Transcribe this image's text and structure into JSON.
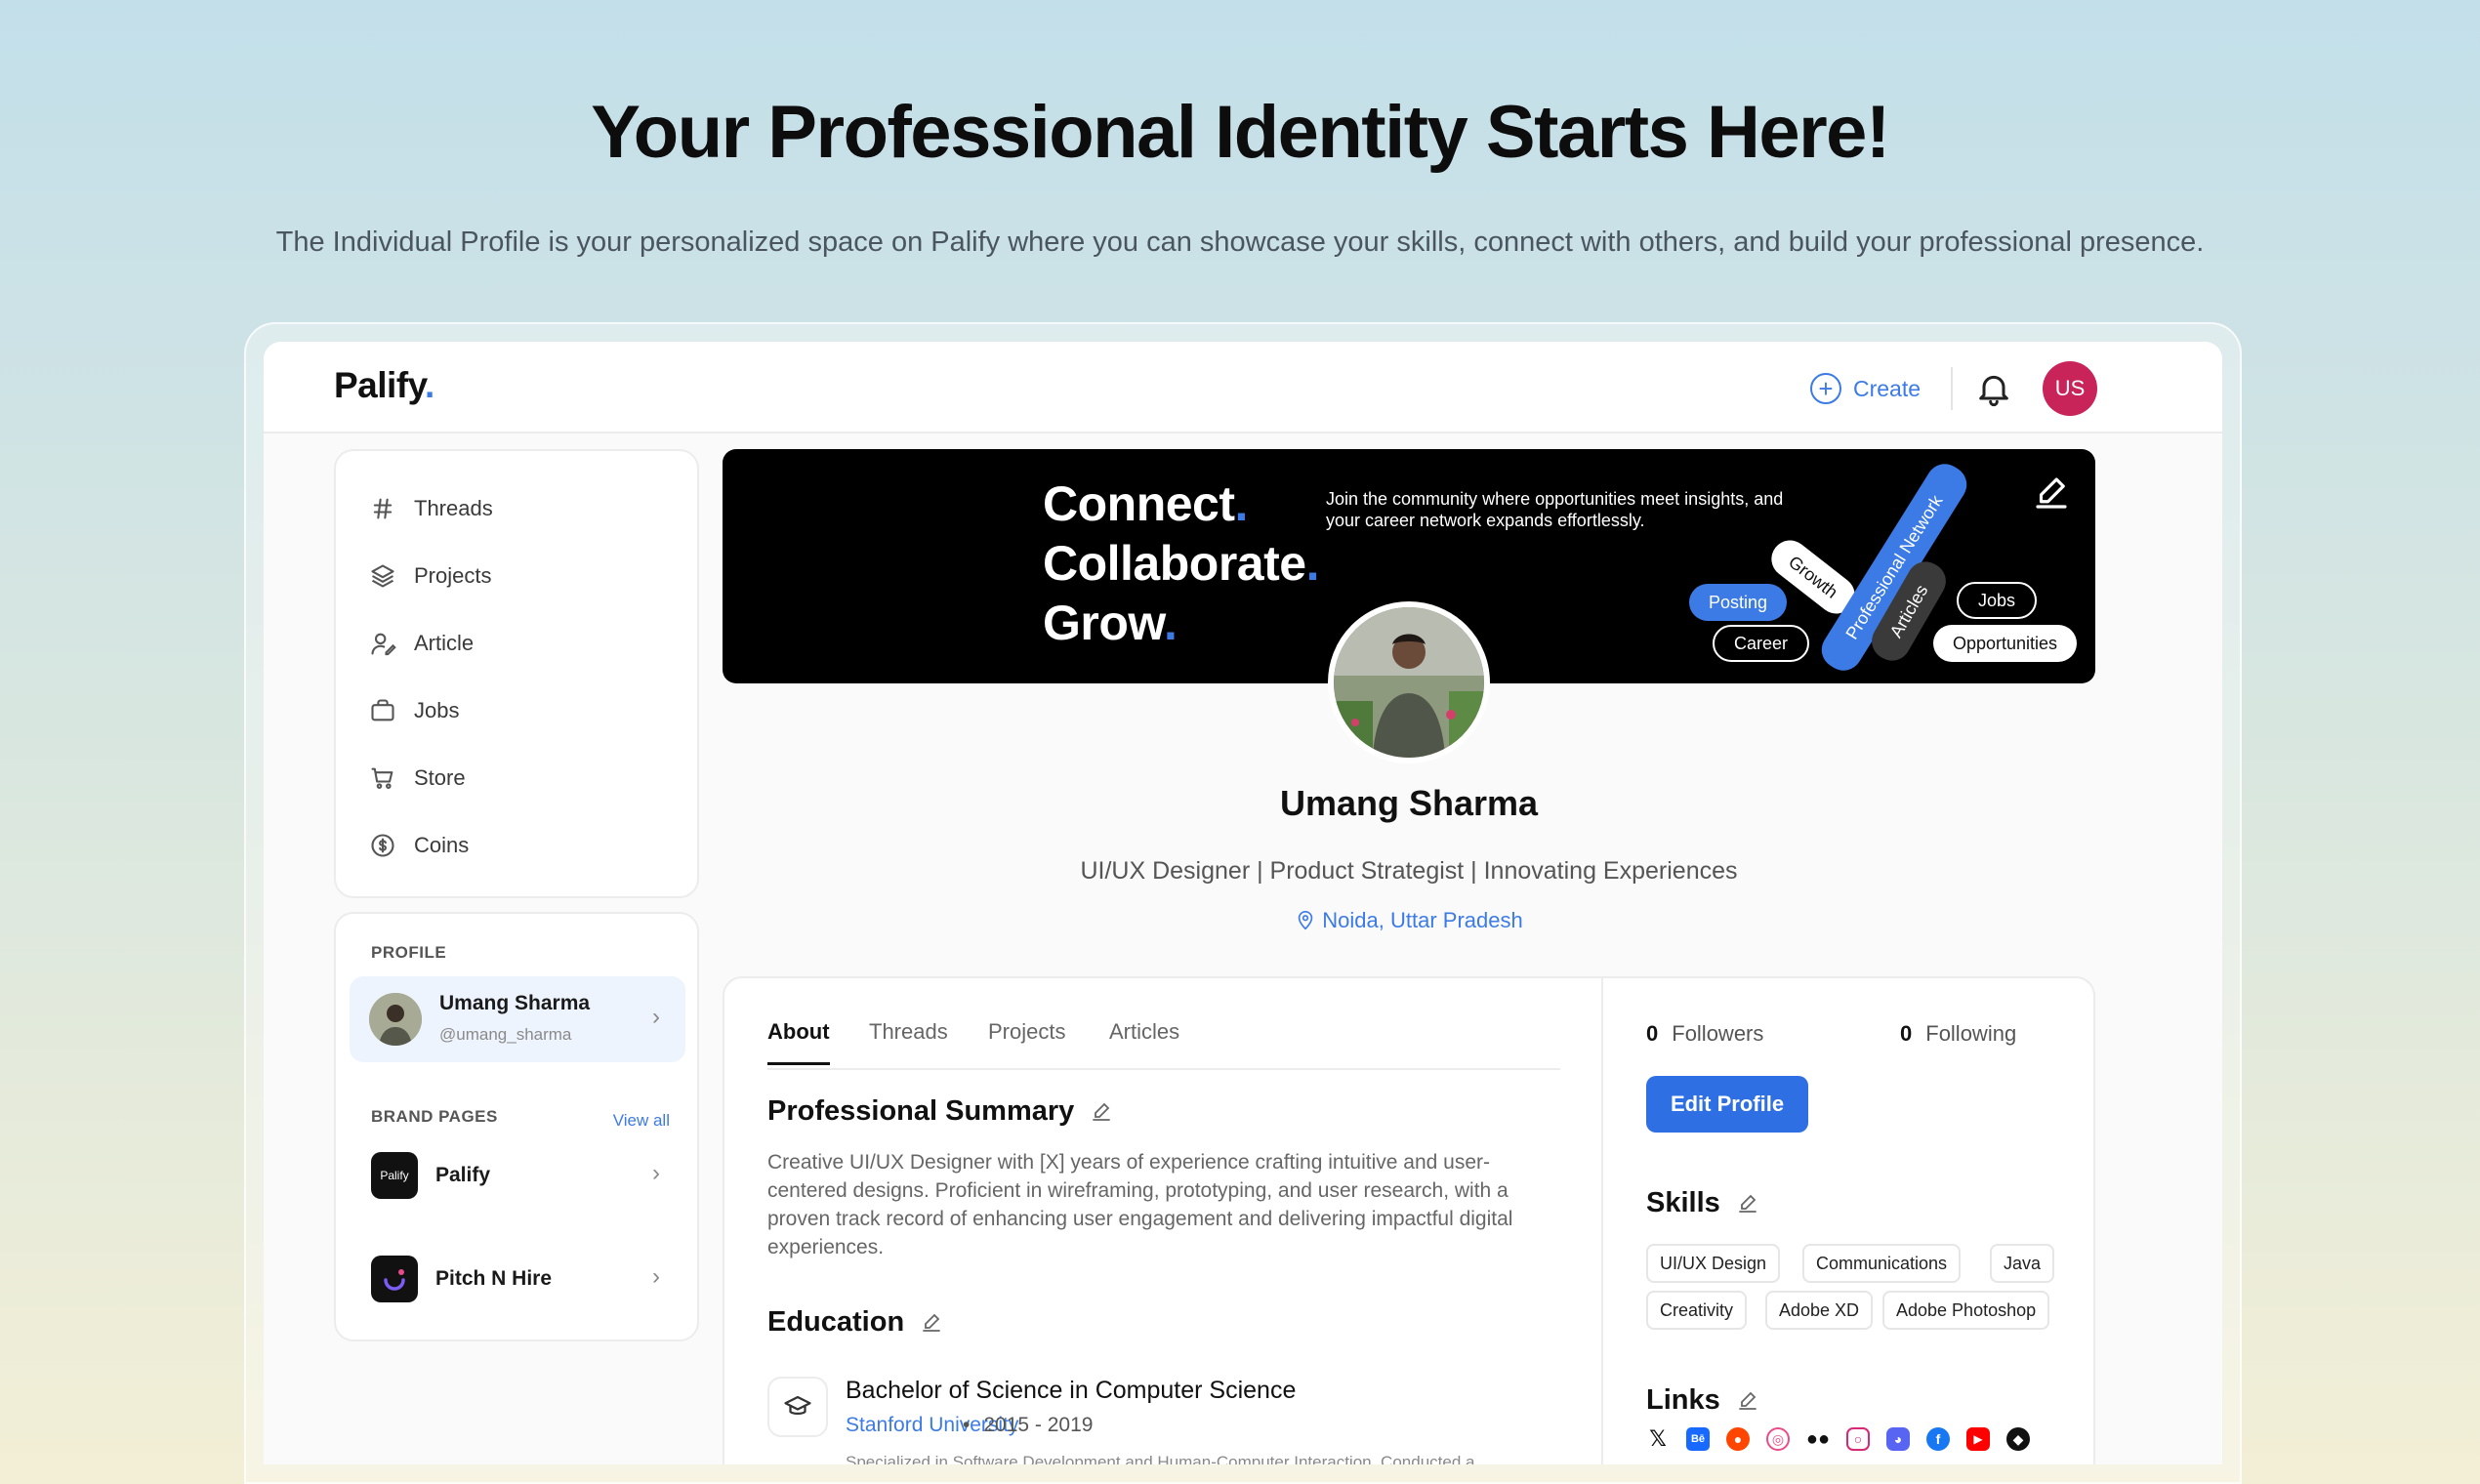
{
  "hero": {
    "title": "Your Professional Identity Starts Here!",
    "subtitle": "The Individual Profile is your personalized space on Palify where you can showcase your skills, connect with others, and build your professional presence."
  },
  "topbar": {
    "logo": "Palify",
    "logo_dot": ".",
    "create_label": "Create",
    "user_initials": "US",
    "accent": "#3c7be6",
    "avatar_color": "#c8245a"
  },
  "nav": {
    "items": [
      {
        "label": "Threads",
        "icon": "hash-icon"
      },
      {
        "label": "Projects",
        "icon": "layers-icon"
      },
      {
        "label": "Article",
        "icon": "user-pen-icon"
      },
      {
        "label": "Jobs",
        "icon": "bag-icon"
      },
      {
        "label": "Store",
        "icon": "cart-icon"
      },
      {
        "label": "Coins",
        "icon": "coin-icon"
      }
    ]
  },
  "profile_panel": {
    "section_label": "PROFILE",
    "name": "Umang Sharma",
    "handle": "@umang_sharma",
    "brand_label": "BRAND PAGES",
    "view_all": "View all",
    "brands": [
      {
        "name": "Palify",
        "logo_text": "Palify"
      },
      {
        "name": "Pitch N Hire",
        "logo_text": ""
      }
    ]
  },
  "banner": {
    "line1": "Connect",
    "line2": "Collaborate",
    "line3": "Grow",
    "dot": ".",
    "copy": "Join the community where opportunities meet insights, and your career network expands effortlessly.",
    "pills": {
      "posting": "Posting",
      "growth": "Growth",
      "career": "Career",
      "network": "Professional Network",
      "articles": "Articles",
      "jobs": "Jobs",
      "opportunities": "Opportunities"
    }
  },
  "profile": {
    "name": "Umang Sharma",
    "title": "UI/UX Designer | Product Strategist | Innovating Experiences",
    "location": "Noida, Uttar Pradesh"
  },
  "tabs": [
    "About",
    "Threads",
    "Projects",
    "Articles"
  ],
  "about": {
    "summary_heading": "Professional Summary",
    "summary": "Creative UI/UX Designer with [X] years of experience crafting intuitive and user-centered designs. Proficient in wireframing, prototyping, and user research, with a proven track record of enhancing user engagement and delivering impactful digital experiences.",
    "education_heading": "Education",
    "degree": "Bachelor of Science in Computer Science",
    "university": "Stanford University",
    "years": "2015 - 2019",
    "separator": "•",
    "edu_desc": "Specialized in Software Development and Human-Computer Interaction. Conducted a"
  },
  "stats": {
    "followers_count": "0",
    "followers_label": "Followers",
    "following_count": "0",
    "following_label": "Following"
  },
  "edit_profile_label": "Edit Profile",
  "skills_heading": "Skills",
  "skills": [
    "UI/UX Design",
    "Communications",
    "Java",
    "Creativity",
    "Adobe XD",
    "Adobe Photoshop"
  ],
  "links_heading": "Links",
  "links": [
    "x-icon",
    "behance-icon",
    "reddit-icon",
    "dribbble-icon",
    "medium-icon",
    "instagram-icon",
    "discord-icon",
    "facebook-icon",
    "youtube-icon",
    "github-icon"
  ]
}
